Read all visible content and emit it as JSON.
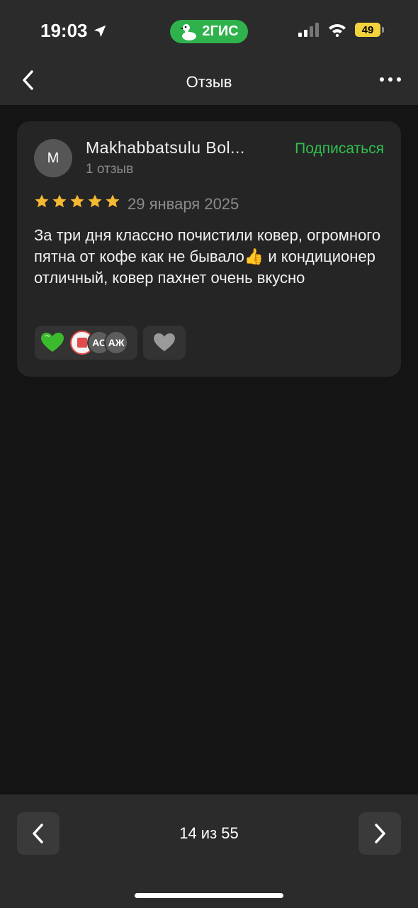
{
  "status_bar": {
    "time": "19:03",
    "app_badge": "2ГИС",
    "battery": "49",
    "battery_color": "#f1d33b"
  },
  "nav": {
    "title": "Отзыв",
    "back_icon": "chevron-left-icon",
    "more_icon": "more-icon"
  },
  "review": {
    "author_initial": "M",
    "author_name": "Makhabbatsulu Bol...",
    "review_count": "1 отзыв",
    "subscribe_label": "Подписаться",
    "rating": 5,
    "rating_max": 5,
    "date": "29 января 2025",
    "text": "За три дня классно почистили ковер, огромного пятна от кофе как не бывало👍 и кондиционер отличный, ковер пахнет очень вкусно",
    "reactions": {
      "avatars": [
        "АС",
        "АЖ"
      ]
    }
  },
  "pagination": {
    "label": "14 из 55"
  },
  "colors": {
    "accent_green": "#2fc04f",
    "star": "#f5b932"
  }
}
